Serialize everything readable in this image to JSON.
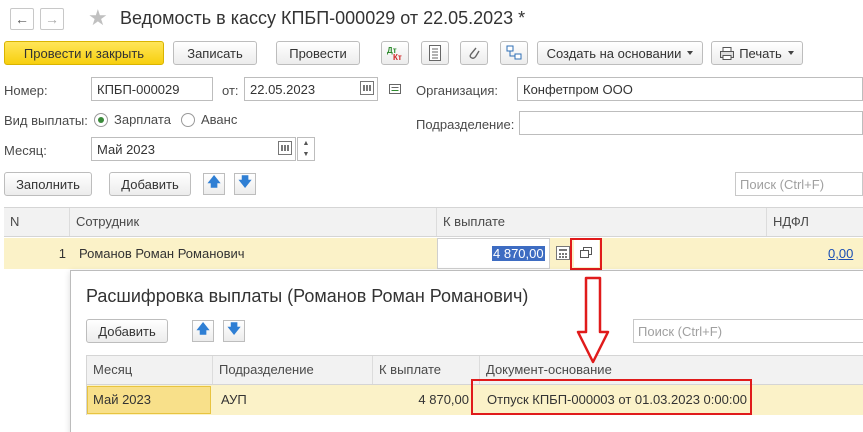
{
  "header": {
    "title": "Ведомость в кассу КПБП-000029 от 22.05.2023 *"
  },
  "toolbar": {
    "post_close": "Провести и закрыть",
    "save": "Записать",
    "post": "Провести",
    "create_based": "Создать на основании",
    "print": "Печать"
  },
  "form": {
    "number_label": "Номер:",
    "number_value": "КПБП-000029",
    "from_label": "от:",
    "date_value": "22.05.2023",
    "org_label": "Организация:",
    "org_value": "Конфетпром ООО",
    "pay_type_label": "Вид выплаты:",
    "pay_salary": "Зарплата",
    "pay_advance": "Аванс",
    "subdivision_label": "Подразделение:",
    "subdivision_value": "",
    "month_label": "Месяц:",
    "month_value": "Май 2023"
  },
  "actions": {
    "fill": "Заполнить",
    "add": "Добавить",
    "search_placeholder": "Поиск (Ctrl+F)"
  },
  "table": {
    "columns": [
      "N",
      "Сотрудник",
      "К выплате",
      "НДФЛ"
    ],
    "rows": [
      {
        "n": "1",
        "employee": "Романов Роман Романович",
        "payout": "4 870,00",
        "ndfl": "0,00"
      }
    ]
  },
  "popup": {
    "title": "Расшифровка выплаты (Романов Роман Романович)",
    "add": "Добавить",
    "search_placeholder": "Поиск (Ctrl+F)",
    "columns": [
      "Месяц",
      "Подразделение",
      "К выплате",
      "Документ-основание"
    ],
    "rows": [
      {
        "month": "Май 2023",
        "subdivision": "АУП",
        "payout": "4 870,00",
        "document": "Отпуск КПБП-000003 от 01.03.2023 0:00:00"
      }
    ]
  },
  "colors": {
    "primary_button": "#f7cf0e",
    "selected_row": "#fbf2c8",
    "highlight_red": "#e01b1b",
    "arrow_blue": "#2f7fd4"
  }
}
